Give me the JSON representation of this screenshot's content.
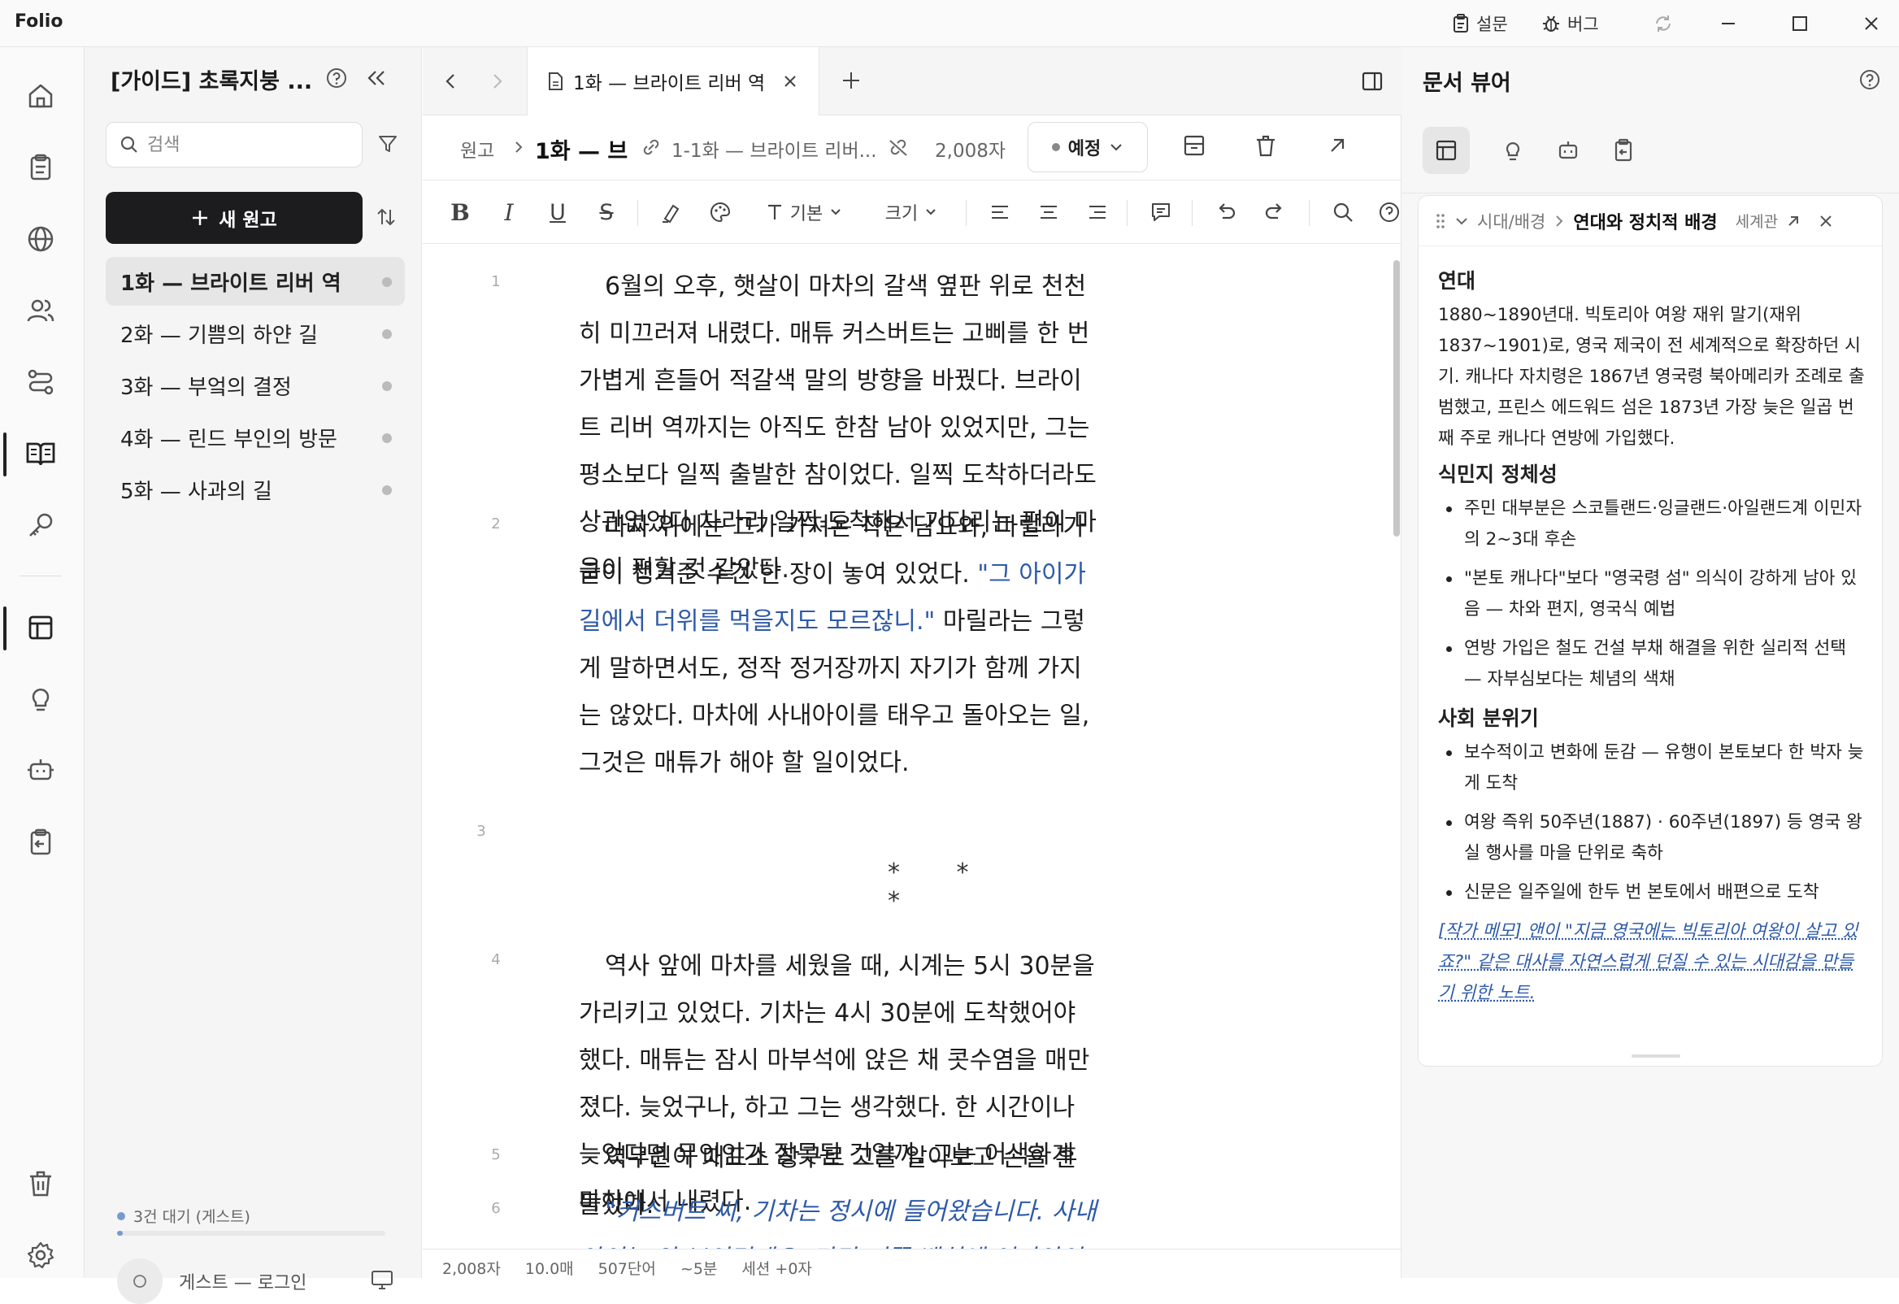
{
  "app": {
    "title": "Folio"
  },
  "titlebar": {
    "survey_label": "설문",
    "bug_label": "버그"
  },
  "sidebar": {
    "project_title": "[가이드] 초록지붕 ...",
    "search_placeholder": "검색",
    "new_button": "새 원고",
    "episodes": [
      {
        "label": "1화 — 브라이트 리버 역",
        "selected": true
      },
      {
        "label": "2화 — 기쁨의 하얀 길",
        "selected": false
      },
      {
        "label": "3화 — 부엌의 결정",
        "selected": false
      },
      {
        "label": "4화 — 린드 부인의 방문",
        "selected": false
      },
      {
        "label": "5화 — 사과의 길",
        "selected": false
      }
    ],
    "queue_text": "3건 대기 (게스트)",
    "queue_progress": 0.02,
    "login_text": "게스트 — 로그인"
  },
  "editor": {
    "tab_label": "1화 — 브라이트 리버 역",
    "breadcrumb_root": "원고",
    "breadcrumb_current": "1화 — 브",
    "link_label": "1-1화 — 브라이트 리버...",
    "char_count": "2,008자",
    "status_label": "예정",
    "font_label": "기본",
    "size_label": "크기",
    "paragraphs": [
      {
        "num": "1",
        "text": "6월의 오후, 햇살이 마차의 갈색 옆판 위로 천천히 미끄러져 내렸다. 매튜 커스버트는 고삐를 한 번 가볍게 흔들어 적갈색 말의 방향을 바꿨다. 브라이트 리버 역까지는 아직도 한참 남아 있었지만, 그는 평소보다 일찍 출발한 참이었다. 일찍 도착하더라도 상관없었다 차라리 일찍 도착해서 기다리는 편이 마음이 편할 것 같았다."
      },
      {
        "num": "2",
        "pre": "마차 위에는 그가 가져온 작은 담요와, 마릴라가 굳이 챙겨준 수건 한 장이 놓여 있었다. ",
        "quote": "\"그 아이가 길에서 더위를 먹을지도 모르잖니.\"",
        "post": " 마릴라는 그렇게 말하면서도, 정작 정거장까지 자기가 함께 가지는 않았다. 마차에 사내아이를 태우고 돌아오는 일, 그것은 매튜가 해야 할 일이었다."
      },
      {
        "num": "3",
        "text": "* * *"
      },
      {
        "num": "4",
        "text": "역사 앞에 마차를 세웠을 때, 시계는 5시 30분을 가리키고 있었다. 기차는 4시 30분에 도착했어야 했다. 매튜는 잠시 마부석에 앉은 채 콧수염을 매만졌다. 늦었구나, 하고 그는 생각했다. 한 시간이나 늦었다면 무엇인가 잘못된 것일까. 그는 어색하게 마차에서 내렸다."
      },
      {
        "num": "5",
        "text": "역무원이 매표소 창구로 그를 알아보고 손을 흔들었다."
      },
      {
        "num": "6",
        "text": "\"커스버트 씨, 기차는 정시에 들어왔습니다. 사내아이는 안 보이던데요. 다만 저쪽 벤치에 여자아이가 한 명 앉아 있더군요. 한참 됐어요.\""
      }
    ],
    "stats": [
      "2,008자",
      "10.0매",
      "507단어",
      "~5분",
      "세션 +0자"
    ]
  },
  "viewer": {
    "title": "문서 뷰어",
    "breadcrumb_parent": "시대/배경",
    "breadcrumb_current": "연대와 정치적 배경",
    "category_label": "세계관",
    "sections": [
      {
        "heading": "연대",
        "text": "1880~1890년대. 빅토리아 여왕 재위 말기(재위 1837~1901)로, 영국 제국이 전 세계적으로 확장하던 시기. 캐나다 자치령은 1867년 영국령 북아메리카 조례로 출범했고, 프린스 에드워드 섬은 1873년 가장 늦은 일곱 번째 주로 캐나다 연방에 가입했다."
      },
      {
        "heading": "식민지 정체성",
        "items": [
          "주민 대부분은 스코틀랜드·잉글랜드·아일랜드계 이민자의 2~3대 후손",
          "\"본토 캐나다\"보다 \"영국령 섬\" 의식이 강하게 남아 있음 — 차와 편지, 영국식 예법",
          "연방 가입은 철도 건설 부채 해결을 위한 실리적 선택 — 자부심보다는 체념의 색채"
        ]
      },
      {
        "heading": "사회 분위기",
        "items": [
          "보수적이고 변화에 둔감 — 유행이 본토보다 한 박자 늦게 도착",
          "여왕 즉위 50주년(1887) · 60주년(1897) 등 영국 왕실 행사를 마을 단위로 축하",
          "신문은 일주일에 한두 번 본토에서 배편으로 도착"
        ]
      }
    ],
    "note": "[작가 메모] 앤이 \"지금 영국에는 빅토리아 여왕이 살고 있죠?\" 같은 대사를 자연스럽게 던질 수 있는 시대감을 만들기 위한 노트."
  }
}
